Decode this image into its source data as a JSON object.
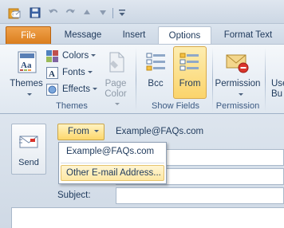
{
  "quick_access": {
    "icons": [
      "outlook-icon",
      "save-icon",
      "undo-icon",
      "redo-icon",
      "move-up-icon",
      "move-down-icon",
      "customize-toolbar-icon"
    ]
  },
  "tabs": [
    {
      "label": "File"
    },
    {
      "label": "Message"
    },
    {
      "label": "Insert"
    },
    {
      "label": "Options"
    },
    {
      "label": "Format Text"
    }
  ],
  "ribbon": {
    "themes_group": {
      "themes_label": "Themes",
      "colors_label": "Colors",
      "fonts_label": "Fonts",
      "effects_label": "Effects",
      "page_color_line1": "Page",
      "page_color_line2": "Color",
      "group_label": "Themes"
    },
    "show_fields_group": {
      "bcc_label": "Bcc",
      "from_label": "From",
      "group_label": "Show Fields"
    },
    "permission_group": {
      "permission_label": "Permission",
      "group_label": "Permission"
    },
    "partial_button": {
      "line1": "Use",
      "line2": "Bu"
    }
  },
  "compose": {
    "send_label": "Send",
    "from_button_label": "From",
    "from_value": "Example@FAQs.com",
    "subject_label": "Subject:"
  },
  "from_dropdown": {
    "items": [
      {
        "label": "Example@FAQs.com"
      },
      {
        "label": "Other E-mail Address..."
      }
    ]
  }
}
